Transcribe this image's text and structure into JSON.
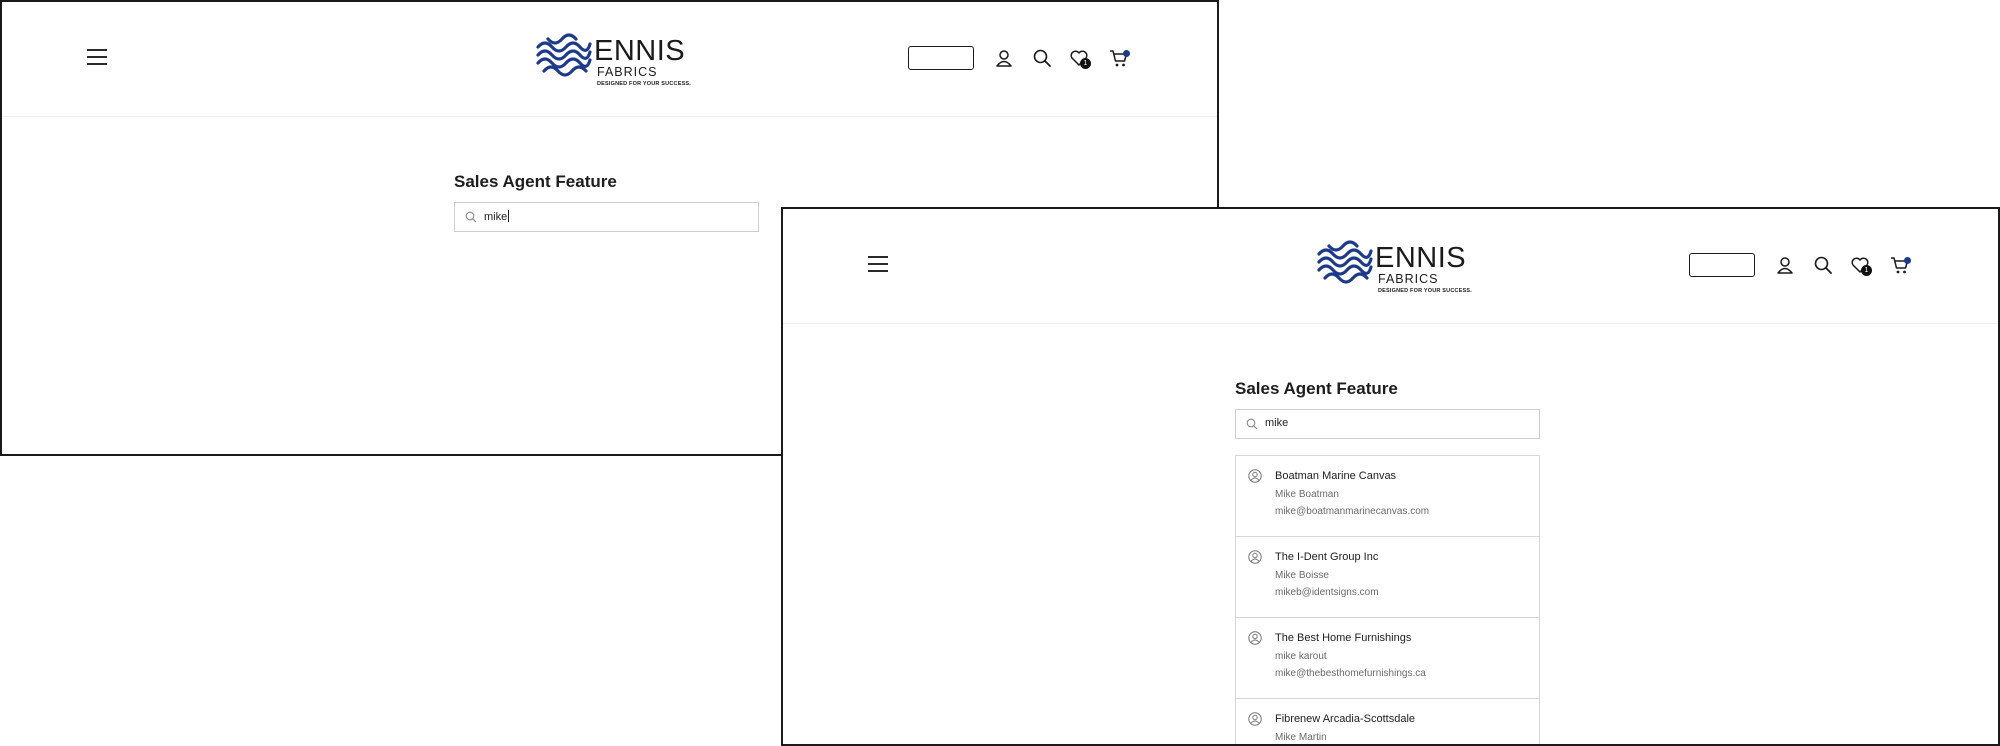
{
  "brand": {
    "name": "ENNIS",
    "sub": "FABRICS",
    "tagline": "DESIGNED FOR YOUR SUCCESS.",
    "mark_color": "#1d3a8a"
  },
  "header": {
    "wishlist_count": "1"
  },
  "page": {
    "title": "Sales Agent Feature"
  },
  "screen_a": {
    "search_value": "mike"
  },
  "screen_b": {
    "search_value": "mike",
    "results": [
      {
        "company": "Boatman Marine Canvas",
        "person": "Mike Boatman",
        "email": "mike@boatmanmarinecanvas.com"
      },
      {
        "company": "The I-Dent Group Inc",
        "person": "Mike Boisse",
        "email": "mikeb@identsigns.com"
      },
      {
        "company": "The Best Home Furnishings",
        "person": "mike karout",
        "email": "mike@thebesthomefurnishings.ca"
      },
      {
        "company": "Fibrenew Arcadia-Scottsdale",
        "person": "Mike Martin",
        "email": ""
      }
    ]
  },
  "icons": {
    "menu": "hamburger-icon",
    "account": "user-icon",
    "search": "search-icon",
    "wishlist": "heart-icon",
    "cart": "cart-icon",
    "result": "user-circle-icon"
  }
}
